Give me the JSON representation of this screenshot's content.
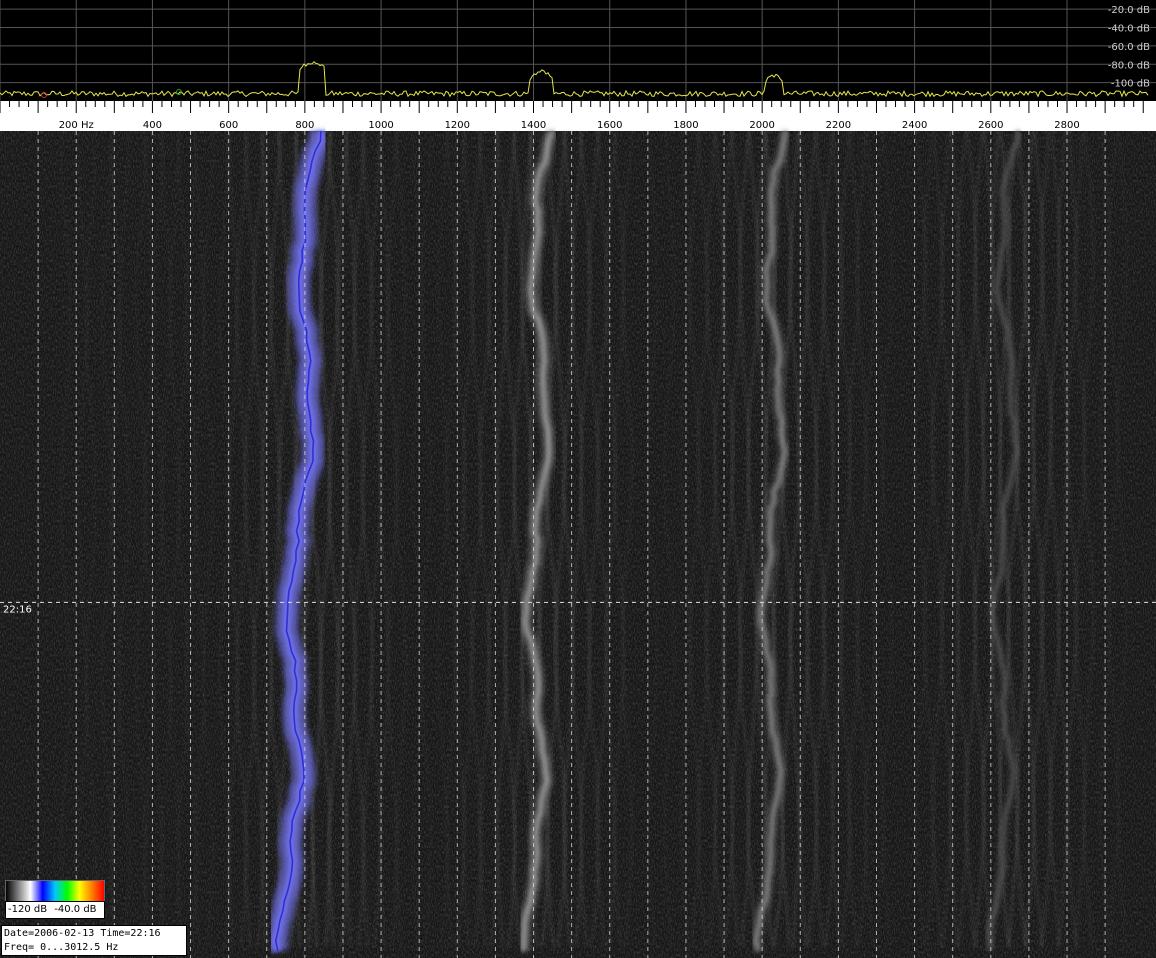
{
  "chart_data": {
    "type": "heatmap",
    "spectrum": {
      "db_labels": [
        "-20.0 dB",
        "-40.0 dB",
        "-60.0 dB",
        "-80.0 dB",
        "-100 dB"
      ],
      "db_values": [
        -20,
        -40,
        -60,
        -80,
        -100
      ],
      "ylim": [
        -120,
        -10
      ],
      "trace_color": "#e6e64a",
      "peaks": [
        {
          "freq": 820,
          "db": -78,
          "width": 70
        },
        {
          "freq": 1420,
          "db": -88,
          "width": 60
        },
        {
          "freq": 2030,
          "db": -92,
          "width": 50
        }
      ],
      "noise_floor_db": -112
    },
    "frequency_axis": {
      "labels": [
        "200  Hz",
        "400",
        "600",
        "800",
        "1000",
        "1200",
        "1400",
        "1600",
        "1800",
        "2000",
        "2200",
        "2400",
        "2600",
        "2800"
      ],
      "label_values": [
        200,
        400,
        600,
        800,
        1000,
        1200,
        1400,
        1600,
        1800,
        2000,
        2200,
        2400,
        2600,
        2800
      ],
      "xlim": [
        0,
        3012.5
      ],
      "grid_step_hz": 200
    },
    "waterfall": {
      "time_label": "22:16",
      "time_marker_fraction": 0.57,
      "carriers": [
        {
          "freq": 820,
          "color": "#6f70e6",
          "strength": 1.0
        },
        {
          "freq": 1425,
          "color": "#9a9a9a",
          "strength": 0.7
        },
        {
          "freq": 2040,
          "color": "#8a8a8a",
          "strength": 0.55
        },
        {
          "freq": 2650,
          "color": "#5e5e5e",
          "strength": 0.35
        }
      ],
      "grid": true
    },
    "colorbar": {
      "min_label": "-120 dB",
      "max_label": "-40.0 dB",
      "colors": [
        "#000000",
        "#808080",
        "#ffffff",
        "#0000ff",
        "#00c8ff",
        "#00ff00",
        "#ffff00",
        "#ff8000",
        "#ff0000"
      ]
    },
    "info": {
      "line1": "Date=2006-02-13 Time=22:16",
      "line2": "Freq= 0...3012.5 Hz"
    }
  }
}
